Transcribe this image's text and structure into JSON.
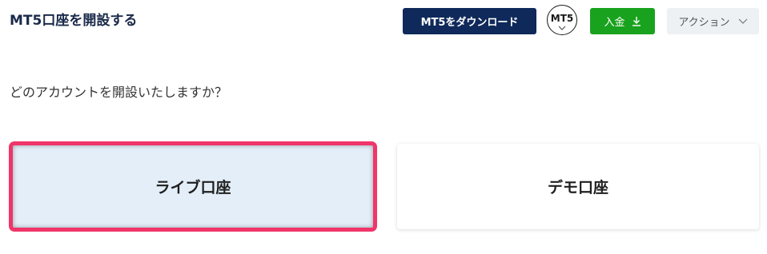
{
  "header": {
    "title": "MT5口座を開設する",
    "download_label": "MT5をダウンロード",
    "platform_badge": "MT5",
    "deposit_label": "入金",
    "action_label": "アクション"
  },
  "main": {
    "question": "どのアカウントを開設いたしますか？",
    "cards": [
      {
        "label": "ライブ口座",
        "selected": true
      },
      {
        "label": "デモ口座",
        "selected": false
      }
    ]
  },
  "colors": {
    "navy": "#0f2a5a",
    "green": "#19a21e",
    "highlight": "#f0356a",
    "selected_bg": "#e3eef8"
  }
}
